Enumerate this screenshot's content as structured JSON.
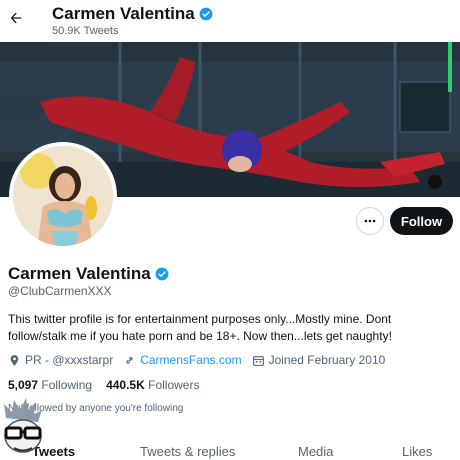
{
  "header": {
    "title": "Carmen Valentina",
    "tweet_count": "50.9K Tweets"
  },
  "profile": {
    "name": "Carmen Valentina",
    "handle": "@ClubCarmenXXX",
    "bio": "This twitter profile is for entertainment purposes only...Mostly mine. Dont follow/stalk me if you hate porn and be 18+. Now then...lets get naughty!",
    "location": "PR - @xxxstarpr",
    "website": "CarmensFans.com",
    "joined": "Joined February 2010",
    "following_count": "5,097",
    "following_label": "Following",
    "followers_count": "440.5K",
    "followers_label": "Followers",
    "followed_by": "Not followed by anyone you're following"
  },
  "actions": {
    "follow_label": "Follow"
  },
  "tabs": [
    {
      "label": "Tweets"
    },
    {
      "label": "Tweets & replies"
    },
    {
      "label": "Media"
    },
    {
      "label": "Likes"
    }
  ],
  "colors": {
    "accent": "#1d9bf0",
    "text": "#0f1419",
    "secondary": "#536471",
    "follow_bg": "#0f1419"
  }
}
